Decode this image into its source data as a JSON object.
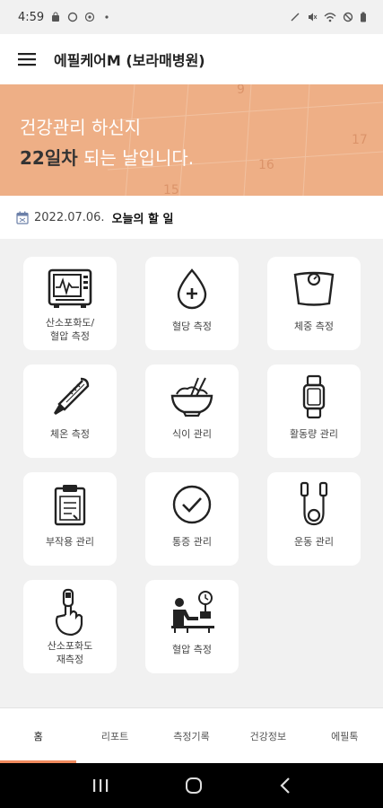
{
  "status_bar": {
    "time": "4:59"
  },
  "app_bar": {
    "title": "에필케어M (보라매병원)"
  },
  "banner": {
    "line1": "건강관리 하신지",
    "day": "22일차",
    "line2_rest": " 되는 날입니다.",
    "deco_numbers": [
      "17",
      "16",
      "15",
      "9"
    ]
  },
  "date_bar": {
    "date": "2022.07.06.",
    "todo": "오늘의 할 일"
  },
  "grid": {
    "items": [
      {
        "label": "산소포화도/\n혈압 측정",
        "icon": "monitor-icon"
      },
      {
        "label": "혈당 측정",
        "icon": "blood-drop-icon"
      },
      {
        "label": "체중 측정",
        "icon": "scale-icon"
      },
      {
        "label": "체온 측정",
        "icon": "thermometer-icon"
      },
      {
        "label": "식이 관리",
        "icon": "rice-bowl-icon"
      },
      {
        "label": "활동량 관리",
        "icon": "smartwatch-icon"
      },
      {
        "label": "부작용 관리",
        "icon": "clipboard-icon"
      },
      {
        "label": "통증 관리",
        "icon": "check-circle-icon"
      },
      {
        "label": "운동 관리",
        "icon": "jump-rope-icon"
      },
      {
        "label": "산소포화도\n재측정",
        "icon": "finger-oximeter-icon"
      },
      {
        "label": "혈압 측정",
        "icon": "blood-pressure-person-icon"
      }
    ]
  },
  "bottom_nav": {
    "items": [
      {
        "label": "홈"
      },
      {
        "label": "리포트"
      },
      {
        "label": "측정기록"
      },
      {
        "label": "건강정보"
      },
      {
        "label": "에필톡"
      }
    ],
    "active_color": "#f08a5d"
  },
  "colors": {
    "banner_bg": "#eeaf86",
    "page_bg": "#f1f1f1",
    "accent": "#f08a5d"
  }
}
